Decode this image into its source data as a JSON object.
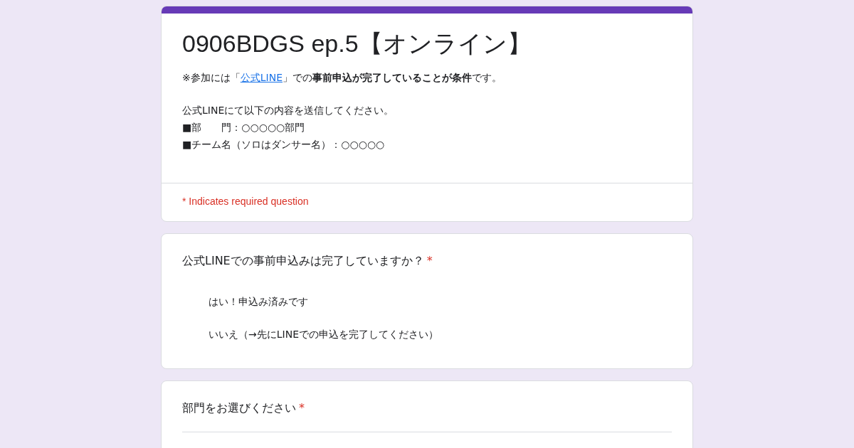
{
  "header": {
    "title": "0906BDGS ep.5【オンライン】",
    "notice": {
      "lead": "※参加には「",
      "link": "公式LINE",
      "trail": "」での**事前申込が完了していることが条件**です。"
    },
    "lines": [
      "公式LINEにて以下の内容を送信してください。",
      "■部　　門：○○○○○部門",
      "■チーム名（ソロはダンサー名）：○○○○○"
    ],
    "required_note": "* Indicates required question"
  },
  "questions": [
    {
      "kind": "choice",
      "text": "公式LINEでの事前申込みは完了していますか？",
      "required_mark": "*",
      "options": [
        "はい！申込み済みです",
        "いいえ（→先にLINEでの申込を完了してください）"
      ]
    },
    {
      "kind": "dropdown",
      "text": "部門をお選びください",
      "required_mark": "*"
    }
  ]
}
